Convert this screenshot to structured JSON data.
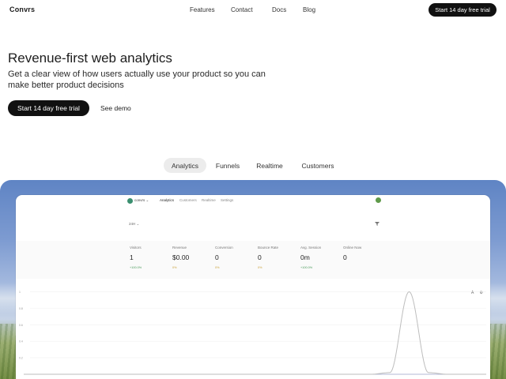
{
  "nav": {
    "logo": "Convrs",
    "links": [
      "Features",
      "Contact",
      "Docs",
      "Blog"
    ],
    "cta": "Start 14 day free trial"
  },
  "hero": {
    "title": "Revenue-first web analytics",
    "subtitle": "Get a clear view of how users actually use your product so you can make better product decisions",
    "cta": "Start 14 day free trial",
    "demo": "See demo"
  },
  "tabs": {
    "items": [
      "Analytics",
      "Funnels",
      "Realtime",
      "Customers"
    ],
    "active": "Analytics"
  },
  "app": {
    "brand": "convrs",
    "menu": [
      "Analytics",
      "Customers",
      "Realtime",
      "Settings"
    ],
    "active_menu": "Analytics",
    "period": "24H",
    "stats": [
      {
        "label": "Visitors",
        "value": "1",
        "delta": "+100.0%",
        "delta_color": "#4a9a5a"
      },
      {
        "label": "Revenue",
        "value": "$0.00",
        "delta": "0%",
        "delta_color": "#c9a23a"
      },
      {
        "label": "Conversion",
        "value": "0",
        "delta": "0%",
        "delta_color": "#c9a23a"
      },
      {
        "label": "Bounce Rate",
        "value": "0",
        "delta": "0%",
        "delta_color": "#c9a23a"
      },
      {
        "label": "Avg. Session",
        "value": "0m",
        "delta": "+100.0%",
        "delta_color": "#4a9a5a"
      },
      {
        "label": "Online Now",
        "value": "0",
        "delta": "",
        "delta_color": "#4a9a5a"
      }
    ],
    "corner_icons": [
      "A",
      "⚙"
    ]
  },
  "chart_data": {
    "type": "line",
    "y_ticks": [
      "1",
      "0.8",
      "0.6",
      "0.4",
      "0.2"
    ],
    "ylim": [
      0,
      1.1
    ],
    "x": [
      0,
      1,
      2,
      3,
      4,
      5,
      6,
      7,
      8,
      9,
      10,
      11,
      12,
      13,
      14,
      15,
      16,
      17,
      18,
      19,
      20,
      21,
      22,
      23,
      24
    ],
    "series": [
      {
        "values": [
          0,
          0,
          0,
          0,
          0,
          0,
          0,
          0,
          0,
          0,
          0,
          0,
          0,
          0,
          0,
          0,
          0,
          0,
          0,
          0.02,
          1,
          0.02,
          0,
          0,
          0
        ],
        "color": "#bdbdbd"
      }
    ],
    "grid": true
  }
}
